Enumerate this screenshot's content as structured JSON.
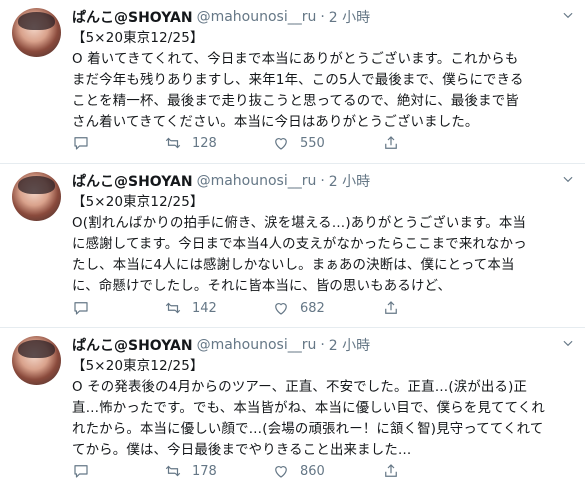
{
  "tweets": [
    {
      "display_name": "ぱんこ@SHOYAN",
      "handle": "@mahounosi__ru",
      "dot": "·",
      "time": "2 小時",
      "lines": [
        "【5×20東京12/25】",
        "O 着いてきてくれて、今日まで本当にありがとうございます。これからも",
        "まだ今年も残りありますし、来年1年、この5人で最後まで、僕らにできる",
        "ことを精一杯、最後まで走り抜こうと思ってるので、絶対に、最後まで皆",
        "さん着いてきてください。本当に今日はありがとうございました。"
      ],
      "retweets": "128",
      "likes": "550"
    },
    {
      "display_name": "ぱんこ@SHOYAN",
      "handle": "@mahounosi__ru",
      "dot": "·",
      "time": "2 小時",
      "lines": [
        "【5×20東京12/25】",
        "O(割れんばかりの拍手に俯き、涙を堪える…)ありがとうございます。本当",
        "に感謝してます。今日まで本当4人の支えがなかったらここまで来れなかっ",
        "たし、本当に4人には感謝しかないし。まぁあの決断は、僕にとって本当",
        "に、命懸けでしたし。それに皆本当に、皆の思いもあるけど、"
      ],
      "retweets": "142",
      "likes": "682"
    },
    {
      "display_name": "ぱんこ@SHOYAN",
      "handle": "@mahounosi__ru",
      "dot": "·",
      "time": "2 小時",
      "lines": [
        "【5×20東京12/25】",
        "O その発表後の4月からのツアー、正直、不安でした。正直…(涙が出る)正",
        "直…怖かったです。でも、本当皆がね、本当に優しい目で、僕らを見ててくれ",
        "れたから。本当に優しい顔で…(会場の頑張れー！に頷く智)見守っててくれて",
        "てから。僕は、今日最後までやりきること出来ました…"
      ],
      "retweets": "178",
      "likes": "860"
    }
  ],
  "icons": {
    "reply": "reply-icon",
    "retweet": "retweet-icon",
    "like": "heart-icon",
    "share": "share-icon",
    "menu": "chevron-down-icon"
  },
  "colors": {
    "text": "#14171a",
    "muted": "#657786",
    "divider": "#e6ecf0"
  }
}
